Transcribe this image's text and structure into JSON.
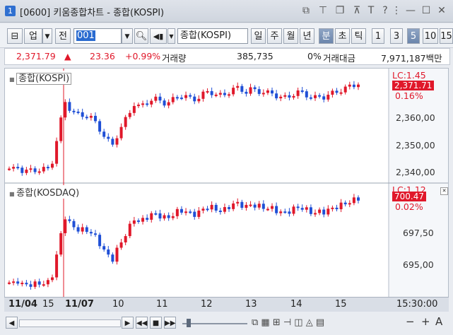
{
  "window": {
    "number": "1",
    "title": "[0600] 키움종합차트 - 종합(KOSPI)"
  },
  "toolbar": {
    "market": "업",
    "all_label": "전",
    "code": "001",
    "name": "종합(KOSPI)",
    "periods": [
      "일",
      "주",
      "월",
      "년",
      "분",
      "초",
      "틱"
    ],
    "selected_period": "분",
    "intervals": [
      "1",
      "3",
      "5",
      "10",
      "15"
    ],
    "selected_interval": "5"
  },
  "quote": {
    "price": "2,371.79",
    "change": "23.36",
    "change_pct": "+0.99%",
    "volume_label": "거래량",
    "volume": "385,735",
    "volume_pct": "0%",
    "amount_label": "거래대금",
    "amount": "7,971,187백만"
  },
  "colors": {
    "up": "#e0182a",
    "down": "#1f4fd6",
    "accent": "#2f6fd0"
  },
  "panels": {
    "kospi": {
      "title": "종합(KOSPI)",
      "lc_label": "LC:1.45",
      "last_value": "2,371.71",
      "pct_change": "0.16%",
      "y_ticks": [
        "2,360,00",
        "2,350,00",
        "2,340,00"
      ]
    },
    "kosdaq": {
      "title": "종합(KOSDAQ)",
      "lc_label": "LC:1.12",
      "last_value": "700.47",
      "pct_change": "0.02%",
      "y_ticks": [
        "697,50",
        "695,00"
      ]
    }
  },
  "date_axis": {
    "labels": [
      "11/04",
      "15",
      "11/07",
      "10",
      "11",
      "12",
      "13",
      "14",
      "15"
    ],
    "time": "15:30:00"
  },
  "bottom": {
    "buttons": [
      "◀",
      "▶",
      "◀◀",
      "■",
      "▶▶",
      "−",
      "+",
      "A"
    ]
  }
}
